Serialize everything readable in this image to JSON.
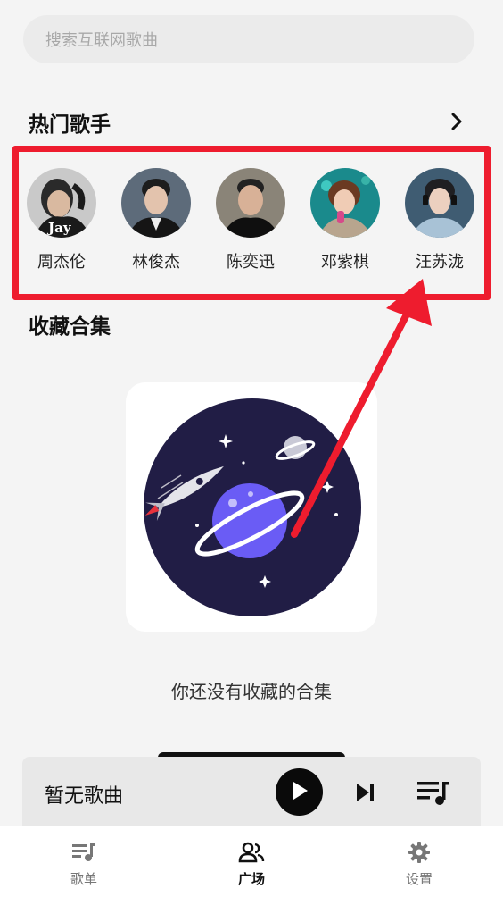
{
  "search": {
    "placeholder": "搜索互联网歌曲"
  },
  "hot_singers": {
    "title": "热门歌手",
    "items": [
      {
        "name": "周杰伦",
        "avatar_text": "Jay"
      },
      {
        "name": "林俊杰"
      },
      {
        "name": "陈奕迅"
      },
      {
        "name": "邓紫棋"
      },
      {
        "name": "汪苏泷"
      }
    ]
  },
  "favorites": {
    "title": "收藏合集",
    "empty_text": "你还没有收藏的合集"
  },
  "player": {
    "title": "暂无歌曲",
    "icons": [
      "play-icon",
      "skip-next-icon",
      "queue-music-icon"
    ]
  },
  "tabs": [
    {
      "label": "歌单",
      "icon": "playlist-icon",
      "active": false
    },
    {
      "label": "广场",
      "icon": "people-icon",
      "active": true
    },
    {
      "label": "设置",
      "icon": "gear-icon",
      "active": false
    }
  ],
  "colors": {
    "accent_annotation": "#ee1c2e",
    "planet_bg": "#211d45",
    "planet": "#6a5cf5"
  }
}
